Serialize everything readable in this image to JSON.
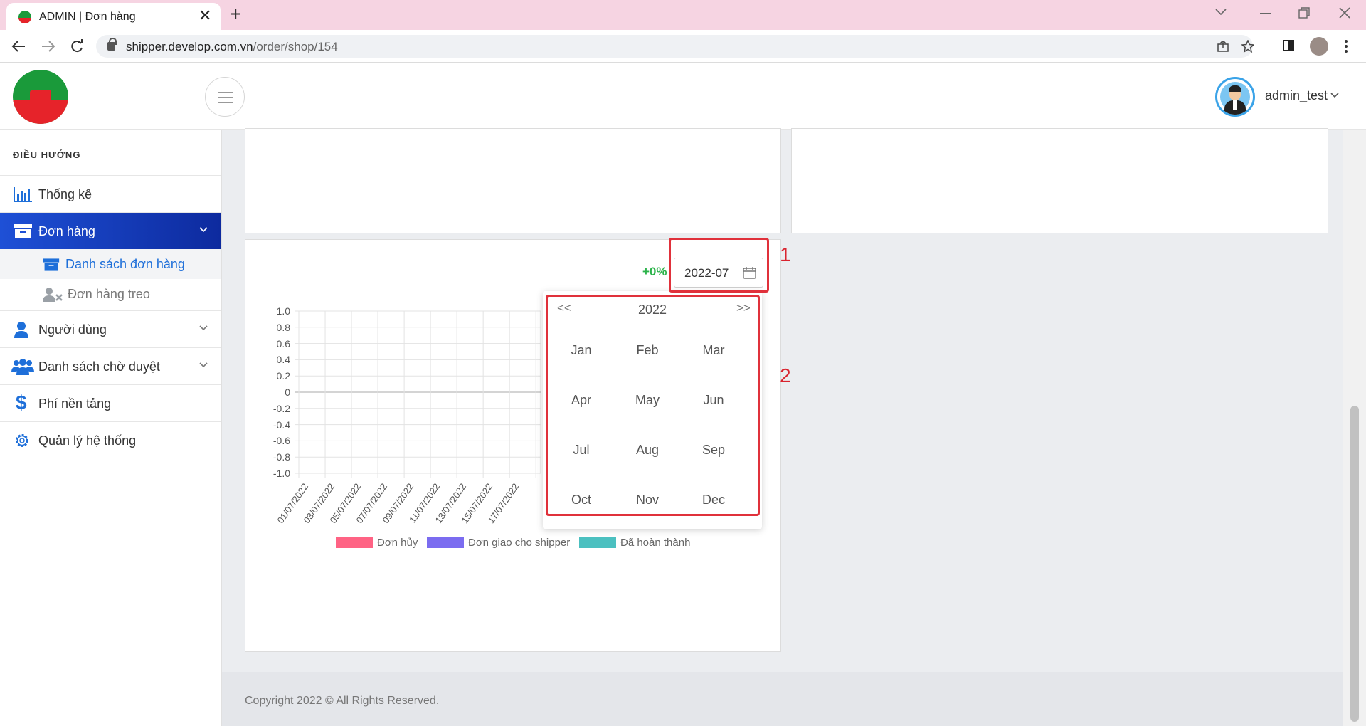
{
  "browser": {
    "tab_title": "ADMIN | Đơn hàng",
    "tab_close": "✕",
    "new_tab": "+",
    "url_host": "shipper.develop.com.vn",
    "url_path": "/order/shop/154"
  },
  "header": {
    "user_name": "admin_test"
  },
  "sidebar": {
    "heading": "ĐIỀU HƯỚNG",
    "items": [
      {
        "label": "Thống kê"
      },
      {
        "label": "Đơn hàng"
      },
      {
        "label": "Danh sách đơn hàng"
      },
      {
        "label": "Đơn hàng treo"
      },
      {
        "label": "Người dùng"
      },
      {
        "label": "Danh sách chờ duyệt"
      },
      {
        "label": "Phí nền tảng"
      },
      {
        "label": "Quản lý hệ thống"
      }
    ]
  },
  "chart_card": {
    "growth": "+0%",
    "date_value": "2022-07"
  },
  "month_picker": {
    "prev": "<<",
    "next": ">>",
    "year": "2022",
    "months": [
      "Jan",
      "Feb",
      "Mar",
      "Apr",
      "May",
      "Jun",
      "Jul",
      "Aug",
      "Sep",
      "Oct",
      "Nov",
      "Dec"
    ]
  },
  "chart_data": {
    "type": "bar",
    "x": [
      "01/07/2022",
      "03/07/2022",
      "05/07/2022",
      "07/07/2022",
      "09/07/2022",
      "11/07/2022",
      "13/07/2022",
      "15/07/2022",
      "17/07/2022"
    ],
    "y_ticks": [
      "1.0",
      "0.8",
      "0.6",
      "0.4",
      "0.2",
      "0",
      "-0.2",
      "-0.4",
      "-0.6",
      "-0.8",
      "-1.0"
    ],
    "ylim": [
      -1.0,
      1.0
    ],
    "series": [
      {
        "name": "Đơn hủy",
        "color": "#ff6384",
        "values": []
      },
      {
        "name": "Đơn giao cho shipper",
        "color": "#7b6cf0",
        "values": []
      },
      {
        "name": "Đã hoàn thành",
        "color": "#4bc0c0",
        "values": []
      }
    ],
    "grid": true,
    "legend": "bottom"
  },
  "annotations": [
    "1",
    "2"
  ],
  "footer": {
    "text": "Copyright 2022 © All Rights Reserved."
  },
  "colors": {
    "accent": "#1e50d6",
    "annotation": "#e0313b",
    "growth": "#2bb34a"
  }
}
